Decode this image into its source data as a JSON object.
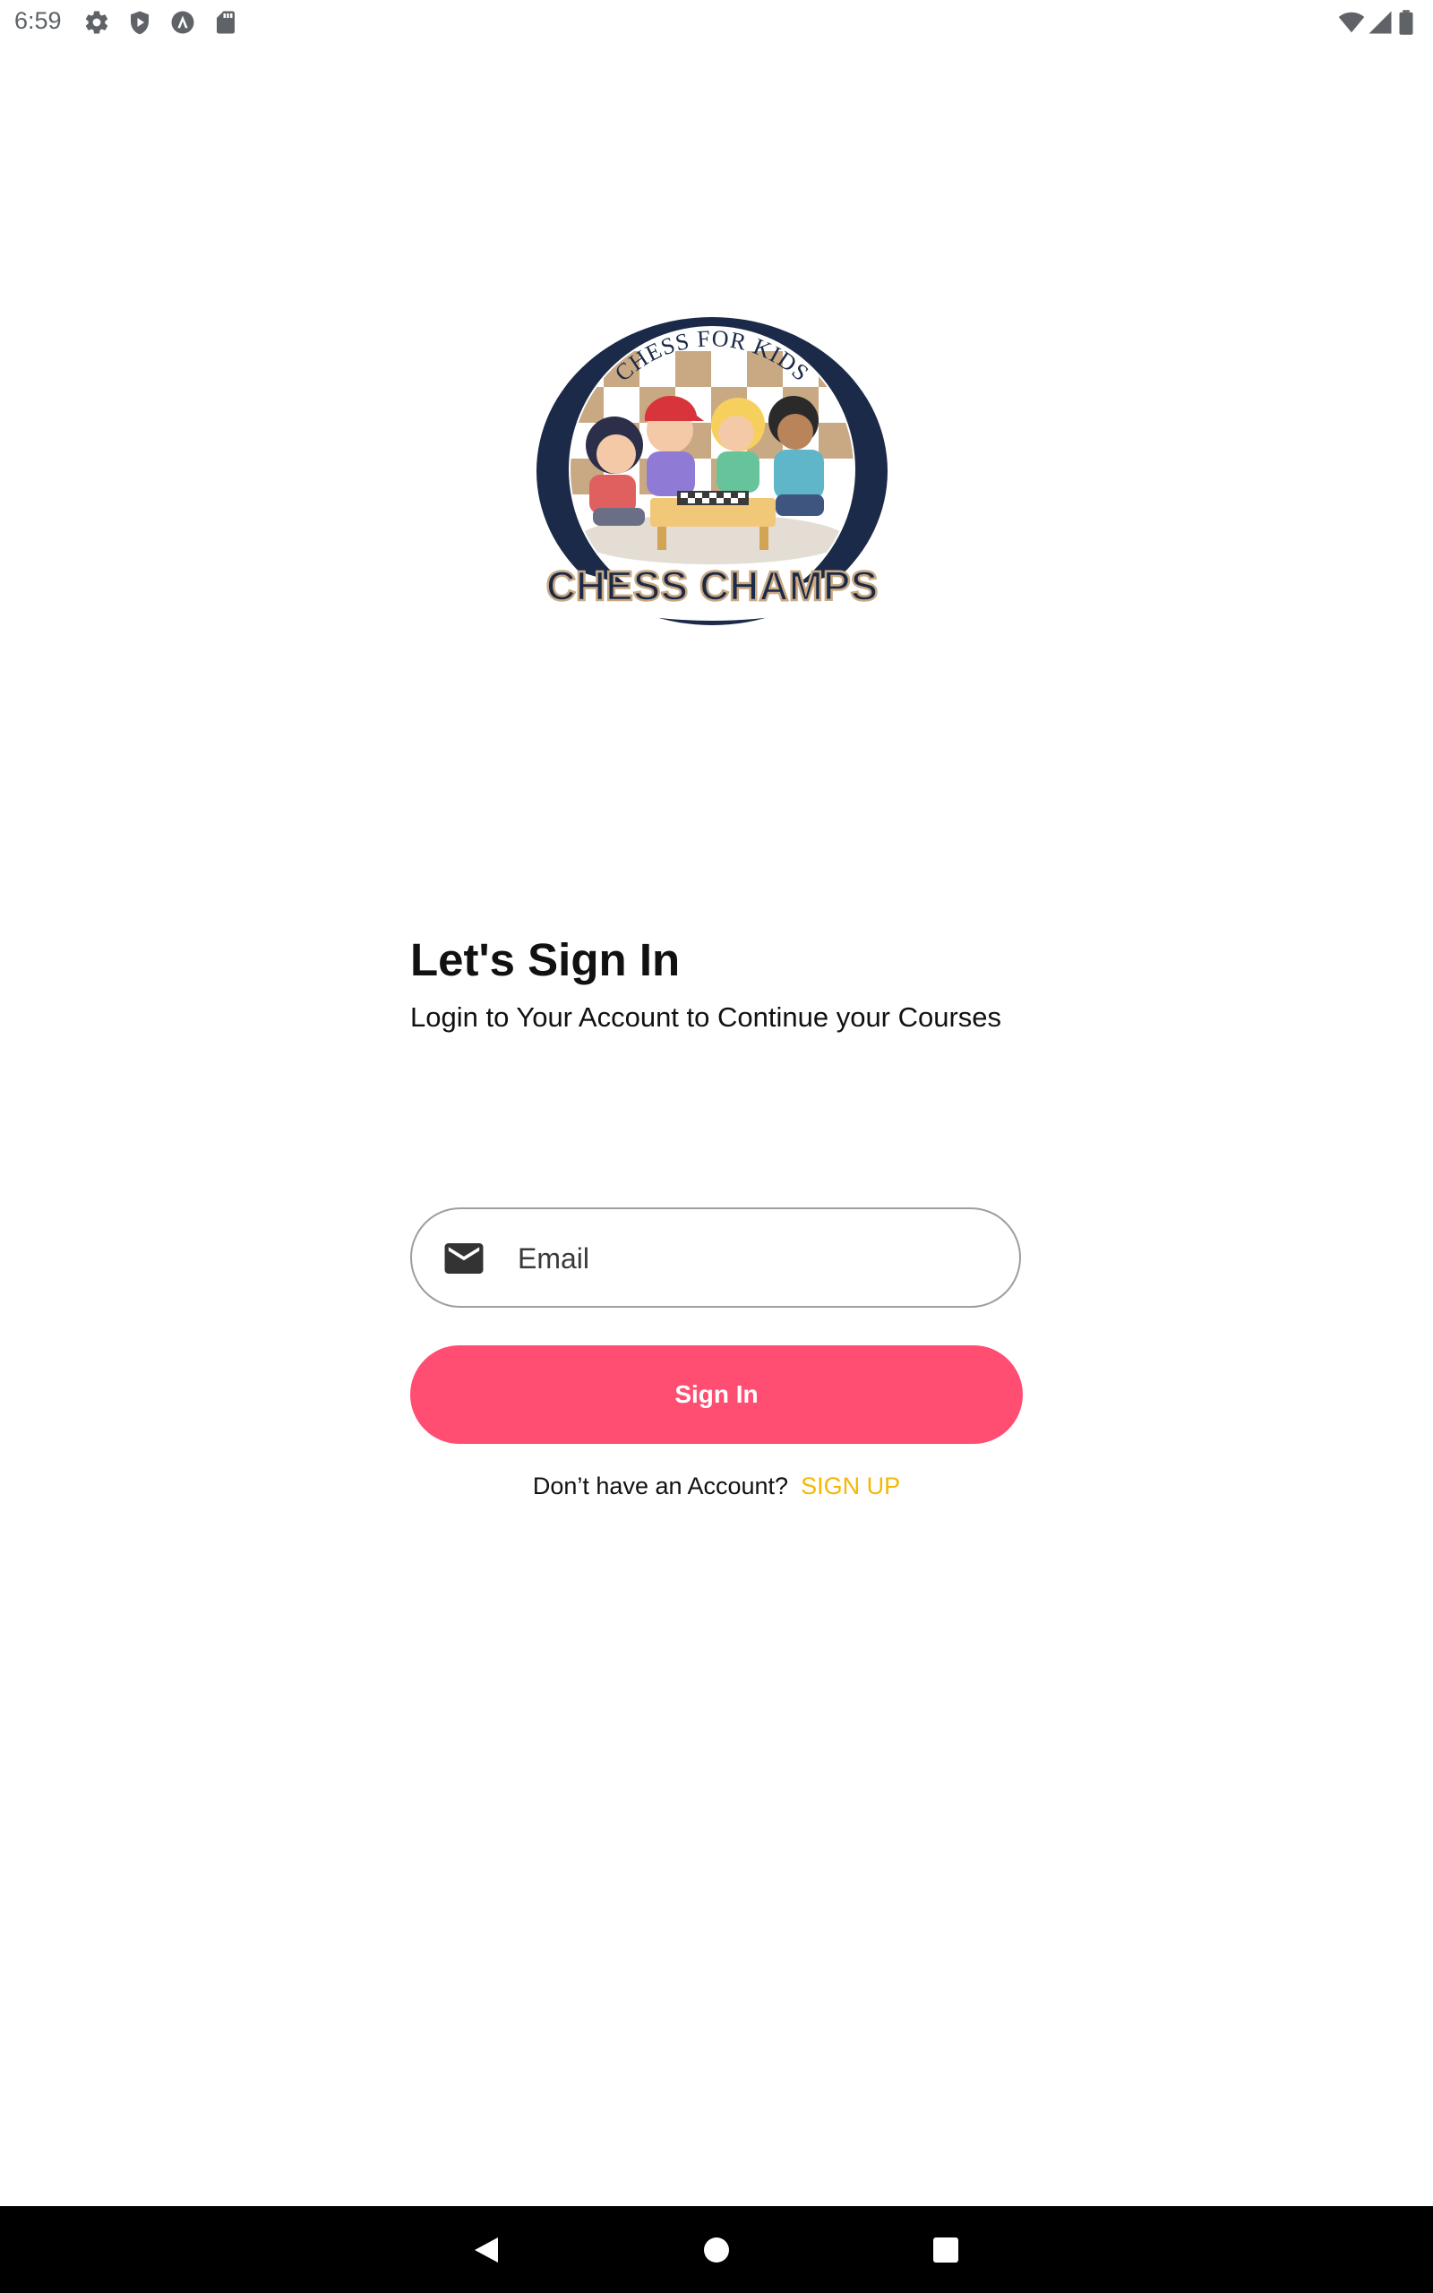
{
  "status_bar": {
    "time": "6:59",
    "left_icons": [
      "gear-icon",
      "shield-play-icon",
      "a-circle-icon",
      "sd-card-icon"
    ],
    "right_icons": [
      "wifi-icon",
      "cell-signal-icon",
      "battery-icon"
    ]
  },
  "logo": {
    "arc_text": "CHESS FOR KIDS",
    "banner_text": "CHESS CHAMPS"
  },
  "heading": {
    "title": "Let's Sign In",
    "subtitle": "Login to Your Account to Continue your Courses"
  },
  "form": {
    "email_placeholder": "Email",
    "email_value": "",
    "email_icon": "mail-icon",
    "sign_in_label": "Sign In"
  },
  "signup": {
    "prompt": "Don’t have an Account?",
    "link_label": "SIGN UP"
  },
  "nav_bar": {
    "buttons": [
      "back-icon",
      "home-icon",
      "recents-icon"
    ]
  },
  "colors": {
    "primary_button": "#ff4e72",
    "signup_link": "#f5b800",
    "text": "#111111",
    "nav_bar_bg": "#000000"
  }
}
